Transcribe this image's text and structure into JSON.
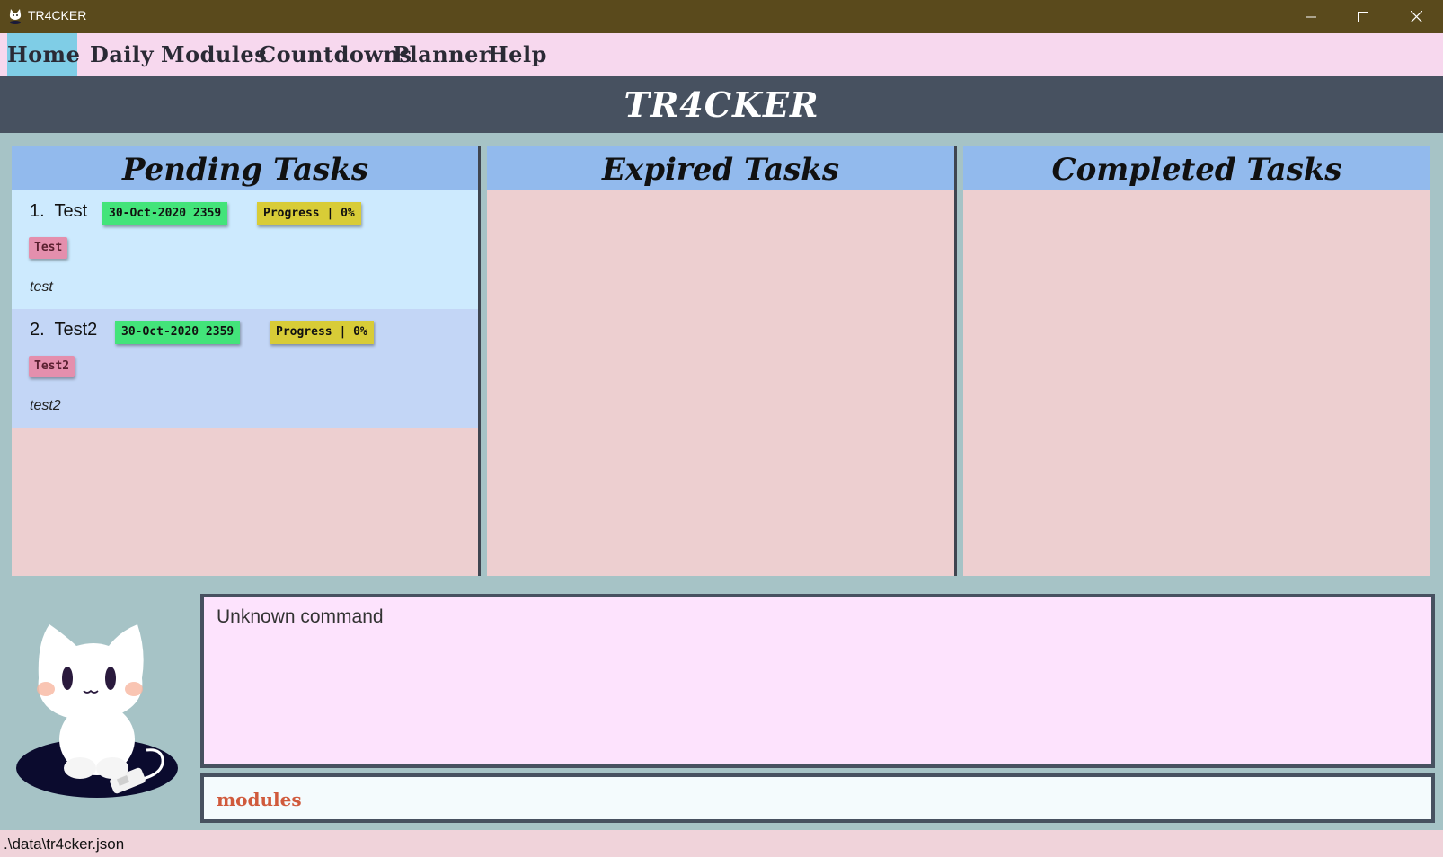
{
  "window": {
    "title": "TR4CKER",
    "icons": {
      "app": "cat-app-icon",
      "minimize": "minimize-icon",
      "maximize": "maximize-icon",
      "close": "close-icon"
    }
  },
  "menu": {
    "items": [
      "Home",
      "Daily",
      "Modules",
      "Countdowns",
      "Planner",
      "Help"
    ],
    "active": "Home"
  },
  "header": {
    "title": "TR4CKER"
  },
  "panels": {
    "pending": {
      "title": "Pending Tasks",
      "tasks": [
        {
          "index": "1.",
          "name": "Test",
          "deadline": "30-Oct-2020 2359",
          "progress": "Progress | 0%",
          "tag": "Test",
          "description": "test"
        },
        {
          "index": "2.",
          "name": "Test2",
          "deadline": "30-Oct-2020 2359",
          "progress": "Progress | 0%",
          "tag": "Test2",
          "description": "test2"
        }
      ]
    },
    "expired": {
      "title": "Expired Tasks",
      "tasks": []
    },
    "completed": {
      "title": "Completed Tasks",
      "tasks": []
    }
  },
  "result": {
    "text": "Unknown command"
  },
  "command": {
    "value": "modules"
  },
  "status": {
    "file_path": ".\\data\\tr4cker.json"
  },
  "colors": {
    "title_bar": "#5a4a1c",
    "menu_bar": "#f7d8ee",
    "menu_active": "#7fcde6",
    "header": "#475160",
    "background": "#a6c3c6",
    "panel_header": "#92baed",
    "panel_body": "#edcfd0",
    "task_odd": "#cdeafe",
    "task_even": "#c3d6f6",
    "deadline_badge": "#43e47a",
    "progress_badge": "#d8cc37",
    "tag_badge": "#e48fad",
    "result_bg": "#fde3fd",
    "command_bg": "#f4fbfd",
    "command_text": "#d05a3c",
    "status_bar": "#f0d3da"
  }
}
